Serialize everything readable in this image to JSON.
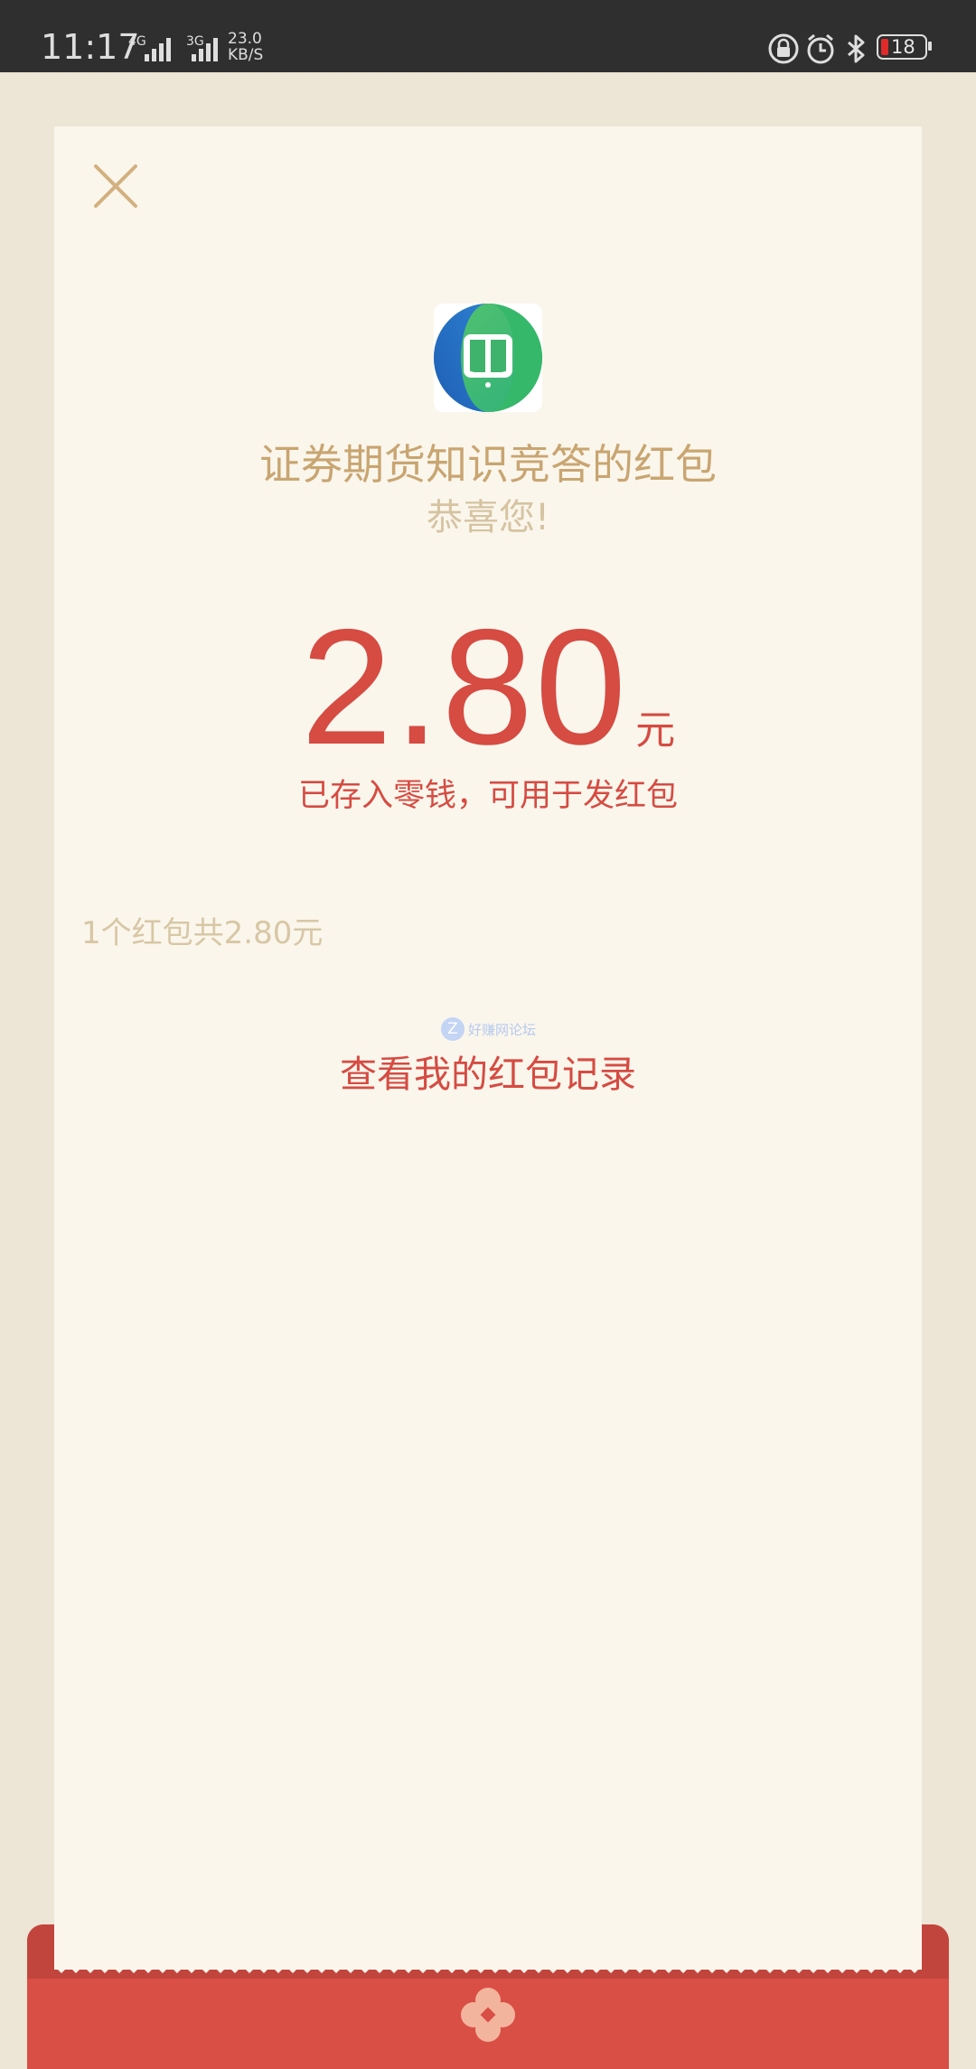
{
  "status_bar": {
    "time": "11:17",
    "net1": "4G",
    "net2": "3G",
    "speed_value": "23.0",
    "speed_unit": "KB/S",
    "battery": "18",
    "icons": [
      "lock-rotation-icon",
      "alarm-icon",
      "bluetooth-icon",
      "battery-icon"
    ]
  },
  "packet": {
    "close_icon": "close-icon",
    "app_icon": "book-app-icon",
    "title": "证券期货知识竞答的红包",
    "subtitle": "恭喜您!",
    "amount": "2.80",
    "unit": "元",
    "note": "已存入零钱，可用于发红包",
    "summary": "1个红包共2.80元",
    "records_link": "查看我的红包记录",
    "watermark": "好赚网论坛",
    "watermark_badge": "Z"
  },
  "colors": {
    "page_bg": "#ede5d5",
    "card_bg": "#faf6ec",
    "accent_gold": "#c9a571",
    "accent_red": "#d64b42",
    "status_bar": "#2f2f2f"
  }
}
